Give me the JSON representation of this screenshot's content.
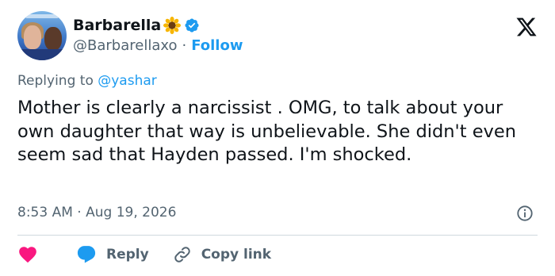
{
  "author": {
    "display_name": "Barbarella",
    "emoji": "sunflower",
    "verified": true,
    "handle": "@Barbarellaxo",
    "follow_label": "Follow"
  },
  "reply": {
    "prefix": "Replying to",
    "mention": "@yashar"
  },
  "tweet": {
    "text": "Mother is clearly a narcissist . OMG, to talk about your own daughter that way is unbelievable. She didn't even seem sad that Hayden passed. I'm shocked.",
    "time": "8:53 AM",
    "separator": "·",
    "date": "Aug 19, 2026"
  },
  "actions": {
    "reply_label": "Reply",
    "copy_link_label": "Copy link"
  },
  "colors": {
    "accent": "#1d9bf0",
    "like": "#f91880",
    "text": "#0f1419",
    "muted": "#536471",
    "divider": "#cfd9de"
  },
  "icons": [
    "x-logo-icon",
    "verified-badge-icon",
    "sunflower-icon",
    "info-icon",
    "heart-icon",
    "reply-bubble-icon",
    "link-icon"
  ]
}
